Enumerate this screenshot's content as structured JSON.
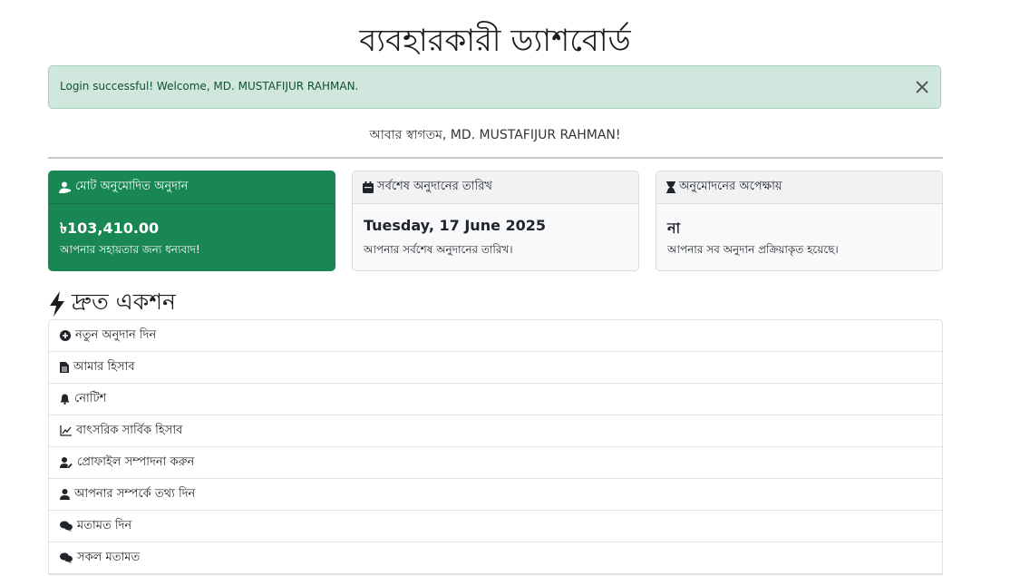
{
  "page": {
    "title": "ব্যবহারকারী ড্যাশবোর্ড"
  },
  "alert": {
    "message": "Login successful! Welcome, MD. MUSTAFIJUR RAHMAN.",
    "close_icon": "close-icon"
  },
  "welcome": "আবার স্বাগতম, MD. MUSTAFIJUR RAHMAN!",
  "cards": [
    {
      "icon": "user-hand-icon",
      "title": "মোট অনুমোদিত অনুদান",
      "value": "৳103,410.00",
      "subtitle": "আপনার সহায়তার জন্য ধন্যবাদ!"
    },
    {
      "icon": "calendar-icon",
      "title": "সর্বশেষ অনুদানের তারিখ",
      "value": "Tuesday, 17 June 2025",
      "subtitle": "আপনার সর্বশেষ অনুদানের তারিখ।"
    },
    {
      "icon": "hourglass-icon",
      "title": "অনুমোদনের অপেক্ষায়",
      "value": "না",
      "subtitle": "আপনার সব অনুদান প্রক্রিয়াকৃত হয়েছে।"
    }
  ],
  "quick_actions": {
    "title": "দ্রুত একশন",
    "icon": "bolt-icon",
    "items": [
      {
        "icon": "plus-circle-icon",
        "label": "নতুন অনুদান দিন"
      },
      {
        "icon": "file-icon",
        "label": "আমার হিসাব"
      },
      {
        "icon": "bell-icon",
        "label": "নোটিশ"
      },
      {
        "icon": "chart-line-icon",
        "label": "বাৎসরিক সার্বিক হিসাব"
      },
      {
        "icon": "user-edit-icon",
        "label": "প্রোফাইল সম্পাদনা করুন"
      },
      {
        "icon": "user-icon",
        "label": "আপনার সম্পর্কে তথ্য দিন"
      },
      {
        "icon": "comments-icon",
        "label": "মতামত দিন"
      },
      {
        "icon": "comments-icon",
        "label": "সকল মতামত"
      }
    ]
  },
  "colors": {
    "success": "#198754",
    "alert_bg": "#d1e7dd",
    "alert_text": "#0f5132"
  }
}
